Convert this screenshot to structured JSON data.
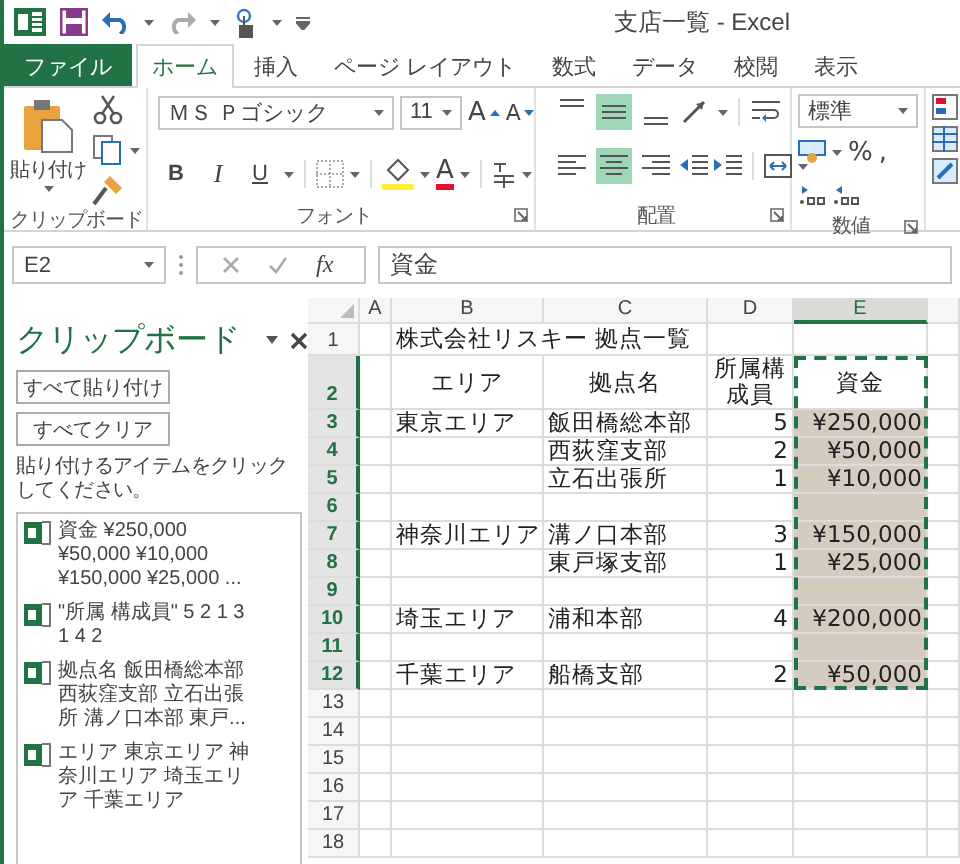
{
  "title_bar": {
    "title": "支店一覧 - Excel"
  },
  "tabs": [
    {
      "label": "ファイル",
      "kind": "file",
      "selected": false
    },
    {
      "label": "ホーム",
      "kind": "tab",
      "selected": true
    },
    {
      "label": "挿入",
      "kind": "tab",
      "selected": false
    },
    {
      "label": "ページ レイアウト",
      "kind": "tab",
      "selected": false
    },
    {
      "label": "数式",
      "kind": "tab",
      "selected": false
    },
    {
      "label": "データ",
      "kind": "tab",
      "selected": false
    },
    {
      "label": "校閲",
      "kind": "tab",
      "selected": false
    },
    {
      "label": "表示",
      "kind": "tab",
      "selected": false
    }
  ],
  "ribbon": {
    "clipboard": {
      "label": "クリップボード",
      "paste": "貼り付け"
    },
    "font": {
      "label": "フォント",
      "font_name": "ＭＳ Ｐゴシック",
      "font_size": "11",
      "grow": "A",
      "shrink": "A",
      "bold": "B",
      "italic": "I",
      "underline": "U",
      "font_color": "A"
    },
    "alignment": {
      "label": "配置",
      "vertical": [
        {
          "kind": "top",
          "selected": false
        },
        {
          "kind": "middle",
          "selected": true
        },
        {
          "kind": "bottom",
          "selected": false
        }
      ],
      "horizontal": [
        {
          "kind": "left",
          "selected": false
        },
        {
          "kind": "center",
          "selected": true
        },
        {
          "kind": "right",
          "selected": false
        }
      ]
    },
    "number": {
      "label": "数値",
      "format": "標準",
      "percent": "%",
      "comma": ","
    }
  },
  "formula_bar": {
    "name_box": "E2",
    "function_label": "fx",
    "value": "資金"
  },
  "clipboard_pane": {
    "title": "クリップボード",
    "buttons": [
      "すべて貼り付け",
      "すべてクリア"
    ],
    "hint": "貼り付けるアイテムをクリックしてください。",
    "items": [
      "資金 ¥250,000\n¥50,000 ¥10,000\n¥150,000 ¥25,000 ...",
      "\"所属 構成員\" 5 2 1 3\n1 4 2",
      "拠点名 飯田橋総本部西荻窪支部 立石出張所 溝ノ口本部 東戸...",
      "エリア 東京エリア 神奈川エリア 埼玉エリア 千葉エリア"
    ]
  },
  "sheet": {
    "columns": [
      {
        "label": "A",
        "selected": false
      },
      {
        "label": "B",
        "selected": false
      },
      {
        "label": "C",
        "selected": false
      },
      {
        "label": "D",
        "selected": false
      },
      {
        "label": "E",
        "selected": true
      }
    ],
    "marquee": true,
    "rows": [
      {
        "label": "1",
        "kind": "title",
        "selected": false,
        "cells": [
          null,
          "株式会社リスキー 拠点一覧",
          null,
          null,
          null
        ]
      },
      {
        "label": "2",
        "kind": "header",
        "selected": true,
        "cells": [
          null,
          "エリア",
          "拠点名",
          "所属構成員",
          "資金"
        ]
      },
      {
        "label": "3",
        "kind": "data",
        "selected": true,
        "cells": [
          null,
          "東京エリア",
          "飯田橋総本部",
          "5",
          "¥250,000"
        ]
      },
      {
        "label": "4",
        "kind": "data",
        "selected": true,
        "cells": [
          null,
          null,
          "西荻窪支部",
          "2",
          "¥50,000"
        ]
      },
      {
        "label": "5",
        "kind": "data",
        "selected": true,
        "cells": [
          null,
          null,
          "立石出張所",
          "1",
          "¥10,000"
        ]
      },
      {
        "label": "6",
        "kind": "data",
        "selected": true
      },
      {
        "label": "7",
        "kind": "data",
        "selected": true,
        "cells": [
          null,
          "神奈川エリア",
          "溝ノ口本部",
          "3",
          "¥150,000"
        ]
      },
      {
        "label": "8",
        "kind": "data",
        "selected": true,
        "cells": [
          null,
          null,
          "東戸塚支部",
          "1",
          "¥25,000"
        ]
      },
      {
        "label": "9",
        "kind": "data",
        "selected": true
      },
      {
        "label": "10",
        "kind": "data",
        "selected": true,
        "cells": [
          null,
          "埼玉エリア",
          "浦和本部",
          "4",
          "¥200,000"
        ]
      },
      {
        "label": "11",
        "kind": "data",
        "selected": true
      },
      {
        "label": "12",
        "kind": "data",
        "selected": true,
        "cells": [
          null,
          "千葉エリア",
          "船橋支部",
          "2",
          "¥50,000"
        ]
      },
      {
        "label": "13",
        "kind": "data",
        "selected": false
      },
      {
        "label": "14",
        "kind": "data",
        "selected": false
      },
      {
        "label": "15",
        "kind": "data",
        "selected": false
      },
      {
        "label": "16",
        "kind": "data",
        "selected": false
      },
      {
        "label": "17",
        "kind": "data",
        "selected": false
      },
      {
        "label": "18",
        "kind": "data",
        "selected": false
      }
    ]
  }
}
